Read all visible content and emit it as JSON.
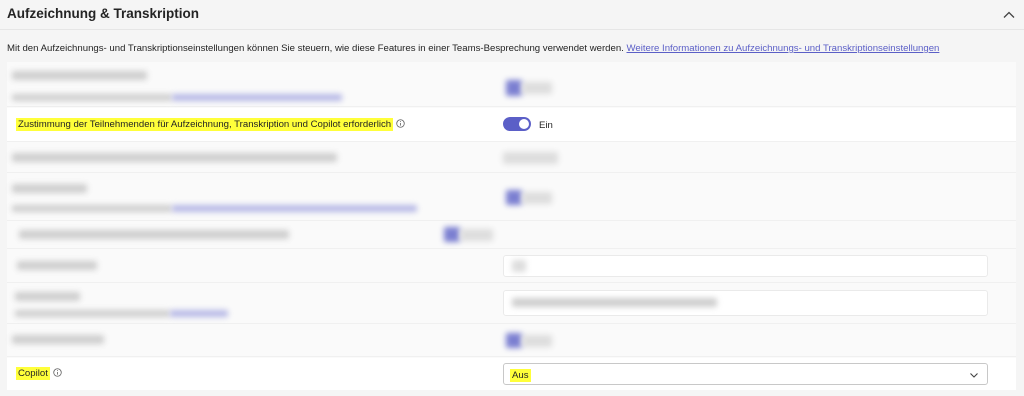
{
  "header": {
    "title": "Aufzeichnung & Transkription",
    "collapse_icon": "chevron-up-icon"
  },
  "description": {
    "text": "Mit den Aufzeichnungs- und Transkriptionseinstellungen können Sie steuern, wie diese Features in einer Teams-Besprechung verwendet werden. ",
    "link": "Weitere Informationen zu Aufzeichnungs- und Transkriptionseinstellungen"
  },
  "consent": {
    "label": "Zustimmung der Teilnehmenden für Aufzeichnung, Transkription und Copilot erforderlich",
    "toggle_state": "on",
    "toggle_label": "Ein"
  },
  "copilot": {
    "label": "Copilot",
    "selected_value": "Aus"
  },
  "colors": {
    "accent": "#5b5fc7",
    "highlight": "#ffff3a"
  }
}
